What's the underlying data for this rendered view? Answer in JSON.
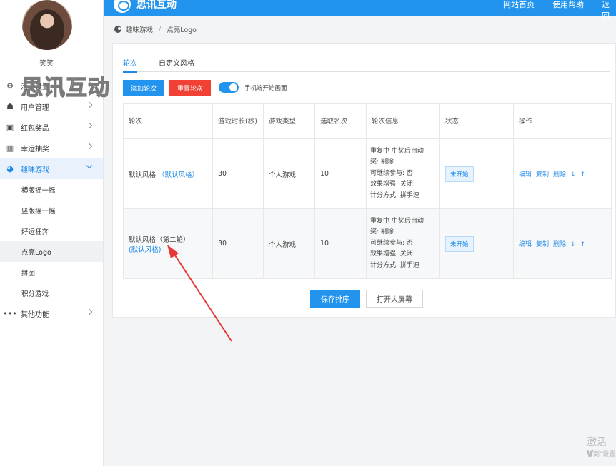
{
  "sidebar": {
    "username": "笑笑",
    "watermark": "思讯互动",
    "menu": [
      {
        "label": "活动设置",
        "icon": "gear-icon"
      },
      {
        "label": "用户管理",
        "icon": "user-icon"
      },
      {
        "label": "红包奖品",
        "icon": "gift-icon"
      },
      {
        "label": "幸运抽奖",
        "icon": "lottery-icon"
      },
      {
        "label": "趣味游戏",
        "icon": "game-icon"
      }
    ],
    "submenu": [
      "横版摇一摇",
      "竖版摇一摇",
      "好运狂奔",
      "点亮Logo",
      "拼图",
      "积分游戏"
    ],
    "more": "其他功能"
  },
  "topbar": {
    "brand": "思讯互动",
    "links": [
      "网站首页",
      "使用帮助",
      "返回"
    ]
  },
  "breadcrumb": [
    "趣味游戏",
    "点亮Logo"
  ],
  "tabs": [
    "轮次",
    "自定义风格"
  ],
  "toolbar": {
    "add": "添加轮次",
    "reset": "重置轮次",
    "toggle_label": "手机端开始画面"
  },
  "table": {
    "headers": [
      "轮次",
      "游戏时长(秒)",
      "游戏类型",
      "选取名次",
      "轮次信息",
      "状态",
      "操作"
    ],
    "rows": [
      {
        "round": "默认风格",
        "round_link": "（默认风格）",
        "duration": "30",
        "type": "个人游戏",
        "rank": "10",
        "info": [
          "重复中  中奖后自动",
          "奖:      剔除",
          "可继续参与: 否",
          "效果增强: 关闭",
          "计分方式: 拼手速"
        ],
        "status": "未开始",
        "ops": [
          "编辑",
          "复制",
          "删除",
          "↓",
          "↑"
        ]
      },
      {
        "round": "默认风格（第二轮）",
        "round_link": "(默认风格)",
        "duration": "30",
        "type": "个人游戏",
        "rank": "10",
        "info": [
          "重复中  中奖后自动",
          "奖:      剔除",
          "可继续参与: 否",
          "效果增强: 关闭",
          "计分方式: 拼手速"
        ],
        "status": "未开始",
        "ops": [
          "编辑",
          "复制",
          "删除",
          "↓",
          "↑"
        ]
      }
    ]
  },
  "footer": {
    "save": "保存排序",
    "bigscreen": "打开大屏幕"
  },
  "windows": {
    "activate": "激活 V",
    "sub": "转到\"设置"
  },
  "colors": {
    "primary": "#2294ee",
    "danger": "#f04134",
    "annotation": "#e53935"
  }
}
